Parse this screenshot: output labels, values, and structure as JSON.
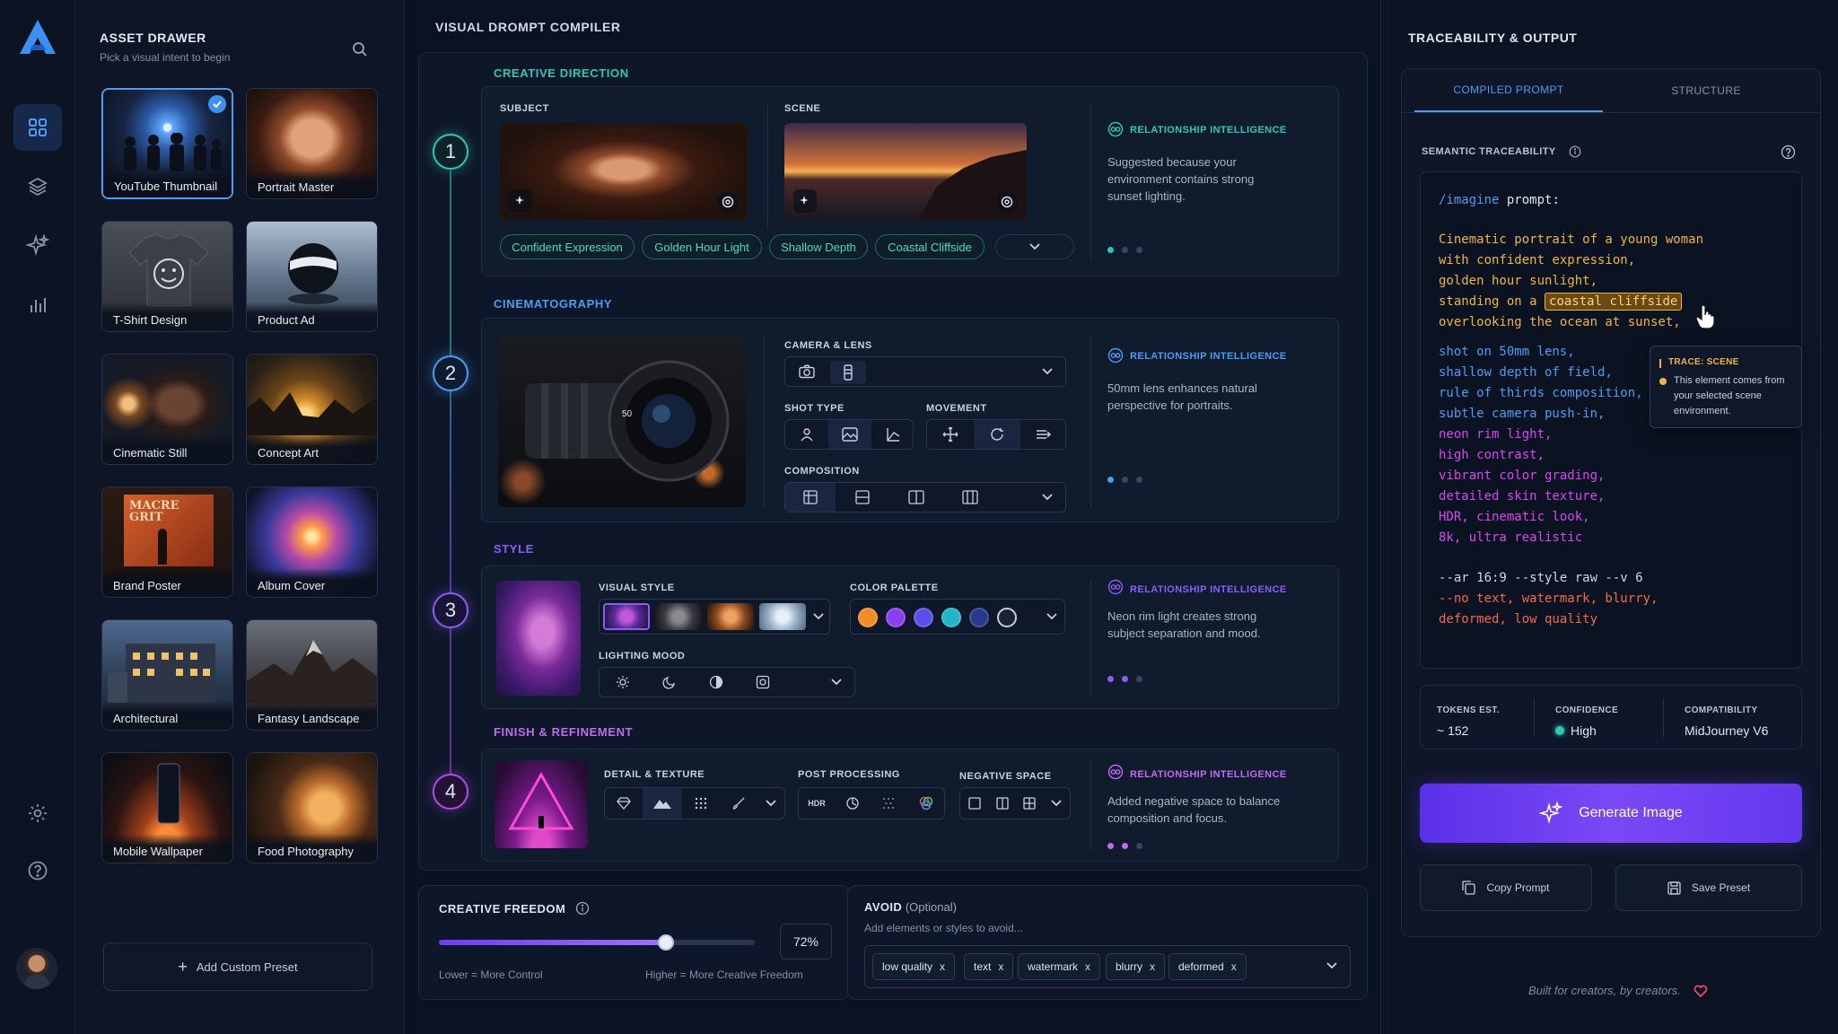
{
  "drawer": {
    "title": "ASSET DRAWER",
    "subtitle": "Pick a visual intent to begin",
    "presets": [
      {
        "label": "YouTube Thumbnail"
      },
      {
        "label": "Portrait Master"
      },
      {
        "label": "T-Shirt Design"
      },
      {
        "label": "Product Ad"
      },
      {
        "label": "Cinematic Still"
      },
      {
        "label": "Concept Art"
      },
      {
        "label": "Brand Poster",
        "art_text": "MACRE GRIT"
      },
      {
        "label": "Album Cover"
      },
      {
        "label": "Architectural"
      },
      {
        "label": "Fantasy Landscape"
      },
      {
        "label": "Mobile Wallpaper"
      },
      {
        "label": "Food Photography"
      }
    ],
    "add_label": "Add Custom Preset"
  },
  "compiler": {
    "title": "VISUAL DROMPT COMPILER",
    "ri_label": "RELATIONSHIP INTELLIGENCE",
    "sections": [
      {
        "number": "1",
        "title": "CREATIVE DIRECTION",
        "subject_label": "SUBJECT",
        "scene_label": "SCENE",
        "chips": [
          "Confident Expression",
          "Golden Hour Light",
          "Shallow Depth",
          "Coastal Cliffside"
        ],
        "ri_text": "Suggested because your environment contains strong sunset lighting."
      },
      {
        "number": "2",
        "title": "CINEMATOGRAPHY",
        "lens_markings": "50",
        "camera_label": "CAMERA & LENS",
        "shot_label": "SHOT TYPE",
        "movement_label": "MOVEMENT",
        "composition_label": "COMPOSITION",
        "ri_text": "50mm lens enhances natural perspective for portraits."
      },
      {
        "number": "3",
        "title": "STYLE",
        "visual_style_label": "VISUAL STYLE",
        "palette_label": "COLOR PALETTE",
        "lighting_label": "LIGHTING MOOD",
        "palette": [
          "#f28c28",
          "#8b3df0",
          "#5a4fe8",
          "#1fb6c8",
          "#2a3a8a",
          "#1a2233"
        ],
        "ri_text": "Neon rim light creates strong subject separation and mood."
      },
      {
        "number": "4",
        "title": "FINISH & REFINEMENT",
        "detail_label": "DETAIL & TEXTURE",
        "post_label": "POST PROCESSING",
        "hdr_label": "HDR",
        "negative_label": "NEGATIVE SPACE",
        "ri_text": "Added negative space to balance composition and focus."
      }
    ],
    "freedom": {
      "title": "CREATIVE FREEDOM",
      "value": 0.72,
      "value_label": "72%",
      "low_label": "Lower = More Control",
      "high_label": "Higher = More Creative Freedom"
    },
    "avoid": {
      "title": "AVOID",
      "optional": "(Optional)",
      "placeholder": "Add elements or styles to avoid...",
      "tags": [
        "low quality",
        "text",
        "watermark",
        "blurry",
        "deformed"
      ]
    }
  },
  "right": {
    "title": "TRACEABILITY & OUTPUT",
    "tabs": [
      "COMPILED PROMPT",
      "STRUCTURE"
    ],
    "trace_label": "SEMANTIC TRACEABILITY",
    "code": {
      "cmd": "/imagine",
      "cmd_rest": " prompt:",
      "gold": [
        "Cinematic portrait of a young woman",
        "with confident expression,",
        "golden hour sunlight,"
      ],
      "gold_pre_highlight": "standing on a ",
      "highlight": "coastal cliffside",
      "gold_after": "overlooking the ocean at sunset,",
      "blue": [
        "shot on 50mm lens,",
        "shallow depth of field,",
        "rule of thirds composition,",
        "subtle camera push-in,"
      ],
      "pink": [
        "neon rim light,",
        "high contrast,",
        "vibrant color grading,",
        "detailed skin texture,",
        "HDR, cinematic look,",
        "8k, ultra realistic"
      ],
      "params": "--ar 16:9 --style raw --v 6",
      "neg1": "--no text, watermark, blurry,",
      "neg2": "deformed, low quality"
    },
    "tooltip": {
      "title": "TRACE: SCENE",
      "text": "This element comes from your selected scene environment."
    },
    "stats": {
      "tokens_label": "TOKENS EST.",
      "tokens_value": "~ 152",
      "confidence_label": "CONFIDENCE",
      "confidence_value": "High",
      "compat_label": "COMPATIBILITY",
      "compat_value": "MidJourney V6"
    },
    "generate_label": "Generate Image",
    "copy_label": "Copy Prompt",
    "save_label": "Save Preset",
    "footer": "Built for creators, by creators."
  },
  "colors": {
    "teal": "#2fc7b4",
    "blue": "#4b9cf2",
    "purple": "#8b5cf6",
    "pink": "#d946ef",
    "gold": "#f0b43c",
    "generate": "#6d3cf2"
  }
}
